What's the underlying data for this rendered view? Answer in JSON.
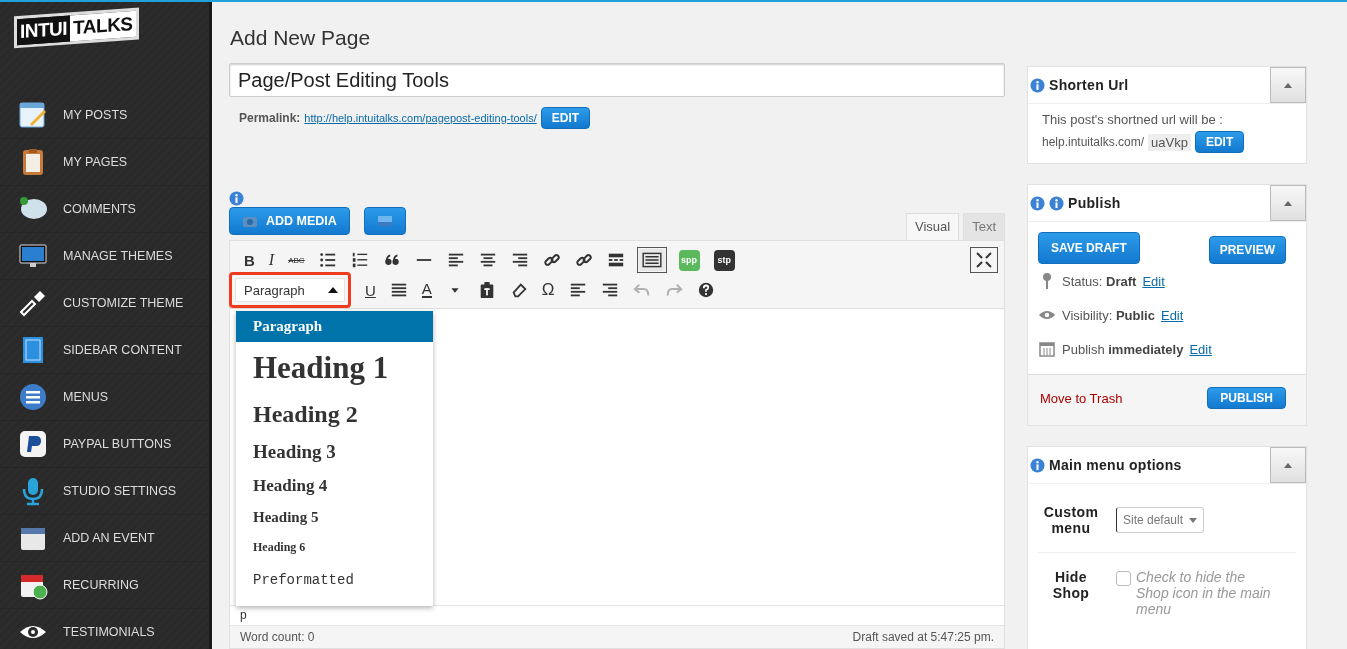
{
  "logo": {
    "left": "INTUI",
    "right": "TALKS"
  },
  "sidebar": {
    "items": [
      {
        "label": "MY POSTS"
      },
      {
        "label": "MY PAGES"
      },
      {
        "label": "COMMENTS"
      },
      {
        "label": "MANAGE THEMES"
      },
      {
        "label": "CUSTOMIZE THEME"
      },
      {
        "label": "SIDEBAR CONTENT"
      },
      {
        "label": "MENUS"
      },
      {
        "label": "PAYPAL BUTTONS"
      },
      {
        "label": "STUDIO SETTINGS"
      },
      {
        "label": "ADD AN EVENT"
      },
      {
        "label": "RECURRING"
      },
      {
        "label": "TESTIMONIALS"
      }
    ]
  },
  "page": {
    "heading": "Add New Page",
    "title_value": "Page/Post Editing Tools",
    "permalink": {
      "label": "Permalink:",
      "url": "http://help.intuitalks.com/pagepost-editing-tools/",
      "button": "EDIT"
    }
  },
  "editor": {
    "add_media": "ADD MEDIA",
    "tabs": [
      {
        "label": "Visual",
        "selected": true
      },
      {
        "label": "Text",
        "selected": false
      }
    ],
    "toolbar_row_1": [
      {
        "kind": "bold",
        "glyph": "B",
        "on": false
      },
      {
        "kind": "italic",
        "glyph": "I",
        "on": false
      },
      {
        "kind": "strike",
        "glyph": "ABC",
        "on": false
      },
      {
        "kind": "bullets",
        "on": false
      },
      {
        "kind": "numbers",
        "on": false
      },
      {
        "kind": "quote",
        "on": false
      },
      {
        "kind": "rule",
        "on": false
      },
      {
        "kind": "align-left",
        "on": false
      },
      {
        "kind": "align-center",
        "on": false
      },
      {
        "kind": "align-right",
        "on": false
      },
      {
        "kind": "link",
        "on": false
      },
      {
        "kind": "unlink",
        "on": false
      },
      {
        "kind": "more",
        "on": false
      },
      {
        "kind": "keyboard",
        "on": true
      },
      {
        "kind": "badge",
        "glyph": "spp",
        "color": "#5cb85c",
        "on": false
      },
      {
        "kind": "badge",
        "glyph": "stp",
        "color": "#333333",
        "on": false
      }
    ],
    "format_select": {
      "value": "Paragraph",
      "highlighted": true
    },
    "toolbar_row_2": [
      {
        "kind": "underline",
        "glyph": "U",
        "disabled": false
      },
      {
        "kind": "justify",
        "disabled": false
      },
      {
        "kind": "text-color",
        "glyph": "A",
        "disabled": false
      },
      {
        "kind": "caret",
        "disabled": false
      },
      {
        "kind": "paste-text",
        "disabled": false
      },
      {
        "kind": "eraser",
        "disabled": false
      },
      {
        "kind": "special-char",
        "glyph": "Ω",
        "disabled": false
      },
      {
        "kind": "outdent",
        "disabled": false
      },
      {
        "kind": "indent",
        "disabled": false
      },
      {
        "kind": "undo",
        "disabled": true
      },
      {
        "kind": "redo",
        "disabled": true
      },
      {
        "kind": "help",
        "disabled": false
      }
    ],
    "format_menu": [
      {
        "kind": "p",
        "label": "Paragraph",
        "selected": true
      },
      {
        "kind": "h1",
        "label": "Heading 1",
        "selected": false
      },
      {
        "kind": "h2",
        "label": "Heading 2",
        "selected": false
      },
      {
        "kind": "h3",
        "label": "Heading 3",
        "selected": false
      },
      {
        "kind": "h4",
        "label": "Heading 4",
        "selected": false
      },
      {
        "kind": "h5",
        "label": "Heading 5",
        "selected": false
      },
      {
        "kind": "h6",
        "label": "Heading 6",
        "selected": false
      },
      {
        "kind": "pre",
        "label": "Preformatted",
        "selected": false
      }
    ],
    "path": "p",
    "word_count": "Word count: 0",
    "saved": "Draft saved at 5:47:25 pm."
  },
  "shorten_url": {
    "title": "Shorten Url",
    "text": "This post's shortned url will be :",
    "base": "help.intuitalks.com/",
    "slug": "uaVkp",
    "button": "EDIT"
  },
  "publish": {
    "title": "Publish",
    "save_draft": "SAVE DRAFT",
    "preview": "PREVIEW",
    "rows": [
      {
        "kind": "status",
        "label": "Status:",
        "value": "Draft",
        "link": "Edit"
      },
      {
        "kind": "visibility",
        "label": "Visibility:",
        "value": "Public",
        "link": "Edit"
      },
      {
        "kind": "schedule",
        "label": "Publish",
        "value": "immediately",
        "link": "Edit"
      }
    ],
    "trash": "Move to Trash",
    "publish_button": "PUBLISH"
  },
  "main_menu_options": {
    "title": "Main menu options",
    "custom_menu": {
      "label": "Custom menu",
      "value": "Site default"
    },
    "hide_shop": {
      "label": "Hide Shop",
      "checked": false,
      "text": "Check to hide the Shop icon in the main menu"
    }
  }
}
